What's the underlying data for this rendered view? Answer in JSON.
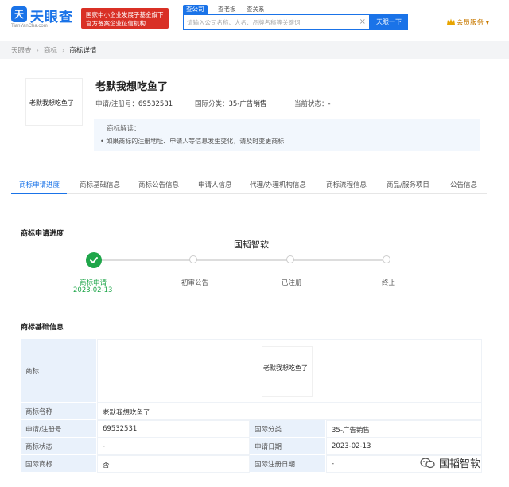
{
  "header": {
    "logo_badge": "天",
    "logo_text": "天眼查",
    "logo_sub": "TianYanCha.com",
    "promo_line1": "国家中小企业发展子基金旗下",
    "promo_line2": "官方备案企业征信机构",
    "search_tabs": [
      "查公司",
      "查老板",
      "查关系"
    ],
    "search_placeholder": "请输入公司名称、人名、品牌名称等关键词",
    "search_clear": "×",
    "search_button": "天眼一下",
    "vip_label": "会员服务",
    "vip_caret": "▾"
  },
  "breadcrumb": [
    "天眼查",
    "商标",
    "商标详情"
  ],
  "trademark": {
    "image_text": "老默我想吃鱼了",
    "title": "老默我想吃鱼了",
    "reg_no_label": "申请/注册号：",
    "reg_no": "69532531",
    "intl_class_label": "国际分类：",
    "intl_class": "35-广告销售",
    "status_label": "当前状态：",
    "status": "-",
    "notice_title": "商标解读：",
    "notice_item": "• 如果商标的注册地址、申请人等信息发生变化，请及时变更商标"
  },
  "tabs": [
    "商标申请进度",
    "商标基础信息",
    "商标公告信息",
    "申请人信息",
    "代理/办理机构信息",
    "商标流程信息",
    "商品/服务项目",
    "公告信息"
  ],
  "progress": {
    "section_title": "商标申请进度",
    "watermark": "国韬智软",
    "steps": [
      {
        "label": "商标申请",
        "date": "2023-02-13",
        "done": true
      },
      {
        "label": "初审公告",
        "done": false
      },
      {
        "label": "已注册",
        "done": false
      },
      {
        "label": "终止",
        "done": false
      }
    ]
  },
  "basic_info": {
    "section_title": "商标基础信息",
    "rows": {
      "trademark_label": "商标",
      "trademark_image_text": "老默我想吃鱼了",
      "name_label": "商标名称",
      "name": "老默我想吃鱼了",
      "reg_no_label": "申请/注册号",
      "reg_no": "69532531",
      "intl_class_label": "国际分类",
      "intl_class": "35-广告销售",
      "status_label": "商标状态",
      "status": "-",
      "apply_date_label": "申请日期",
      "apply_date": "2023-02-13",
      "intl_tm_label": "国际商标",
      "intl_tm": "否",
      "intl_reg_date_label": "国际注册日期",
      "intl_reg_date": "-"
    }
  },
  "corner_watermark": "国韬智软",
  "colors": {
    "primary": "#1a73e8",
    "success": "#1fa64a",
    "promo": "#d93025",
    "label_bg": "#e9f1fb",
    "notice_bg": "#f2f7fd"
  }
}
